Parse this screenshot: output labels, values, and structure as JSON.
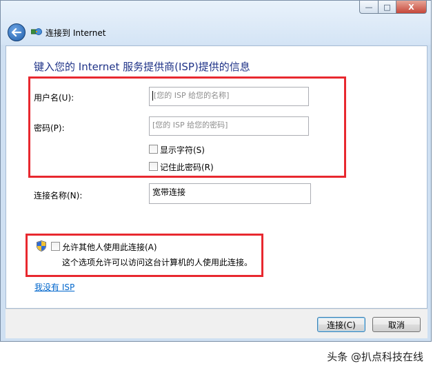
{
  "window": {
    "nav_title": "连接到 Internet",
    "controls": {
      "minimize": "—",
      "maximize": "□",
      "close": "X"
    }
  },
  "form": {
    "heading": "键入您的 Internet 服务提供商(ISP)提供的信息",
    "username_label": "用户名(U):",
    "username_placeholder": "[您的 ISP 给您的名称]",
    "password_label": "密码(P):",
    "password_placeholder": "[您的 ISP 给您的密码]",
    "show_chars_label": "显示字符(S)",
    "remember_password_label": "记住此密码(R)",
    "connection_name_label": "连接名称(N):",
    "connection_name_value": "宽带连接",
    "allow_others_label": "允许其他人使用此连接(A)",
    "allow_others_desc": "这个选项允许可以访问这台计算机的人使用此连接。",
    "no_isp_link": "我没有 ISP"
  },
  "footer": {
    "connect_button": "连接(C)",
    "cancel_button": "取消"
  },
  "watermark": "头条 @扒点科技在线",
  "colors": {
    "heading": "#1e3287",
    "highlight_box": "#e8282f",
    "link": "#0066cc"
  }
}
